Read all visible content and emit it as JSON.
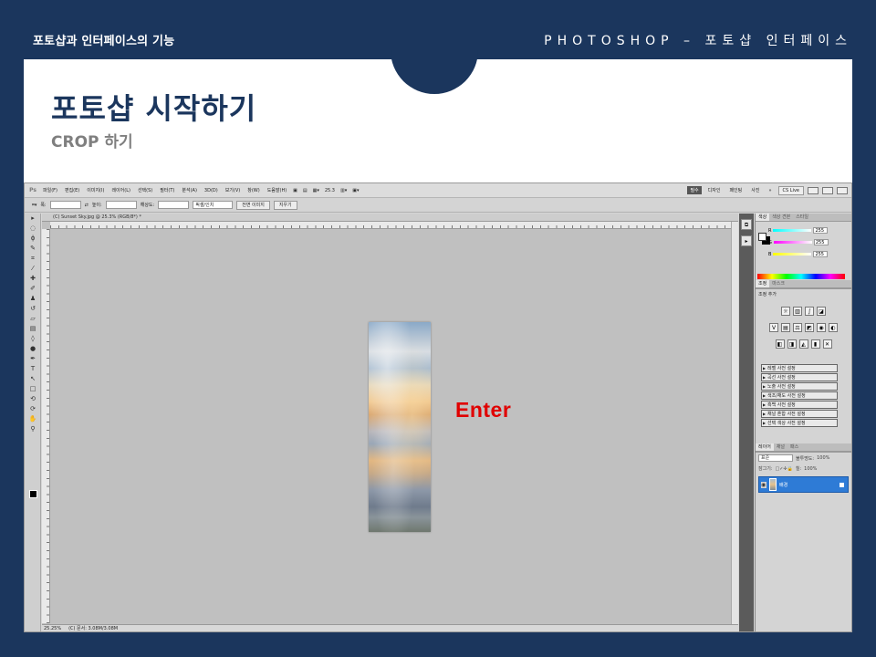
{
  "slide": {
    "top_left": "포토샵과 인터페이스의 기능",
    "top_right": "PHOTOSHOP – 포토샵 인터페이스",
    "title": "포토샵 시작하기",
    "subtitle": "CROP 하기",
    "accent_color": "#1b365d"
  },
  "photoshop": {
    "logo": "Ps",
    "menu": [
      "파일(F)",
      "편집(E)",
      "이미지(I)",
      "레이어(L)",
      "선택(S)",
      "필터(T)",
      "분석(A)",
      "3D(D)",
      "보기(V)",
      "창(W)",
      "도움말(H)"
    ],
    "zoom_field": "25.3",
    "workspaces": [
      "필수",
      "디자인",
      "페인팅",
      "사진"
    ],
    "cs_live": "CS Live",
    "options": {
      "width_label": "폭:",
      "height_label": "높이:",
      "resolution_label": "해상도:",
      "unit": "픽셀/인치",
      "front_image_button": "전면 이미지",
      "clear_button": "지우기"
    },
    "document_tab": "(C) Sunset Sky.jpg @ 25.3% (RGB/8*) *",
    "status": {
      "zoom": "25.25%",
      "doc": "(C) 문서: 3.08M/3.08M"
    },
    "enter_label": "Enter",
    "color_panel": {
      "tabs": [
        "색상",
        "색상 견본",
        "스타일"
      ],
      "channels": [
        {
          "name": "R",
          "value": "255"
        },
        {
          "name": "G",
          "value": "255"
        },
        {
          "name": "B",
          "value": "255"
        }
      ]
    },
    "adjust_panel": {
      "tabs": [
        "조정",
        "마스크"
      ],
      "title": "조정 추가",
      "presets": [
        "레벨 사전 설정",
        "곡선 사전 설정",
        "노출 사전 설정",
        "색조/채도 사전 설정",
        "흑백 사전 설정",
        "채널 혼합 사전 설정",
        "선택 색상 사전 설정"
      ]
    },
    "layers_panel": {
      "tabs": [
        "레이어",
        "채널",
        "패스"
      ],
      "blend_mode": "표준",
      "opacity_label": "불투명도:",
      "opacity": "100%",
      "lock_label": "잠그기:",
      "fill_label": "칠:",
      "fill": "100%",
      "layer_name": "배경"
    }
  }
}
